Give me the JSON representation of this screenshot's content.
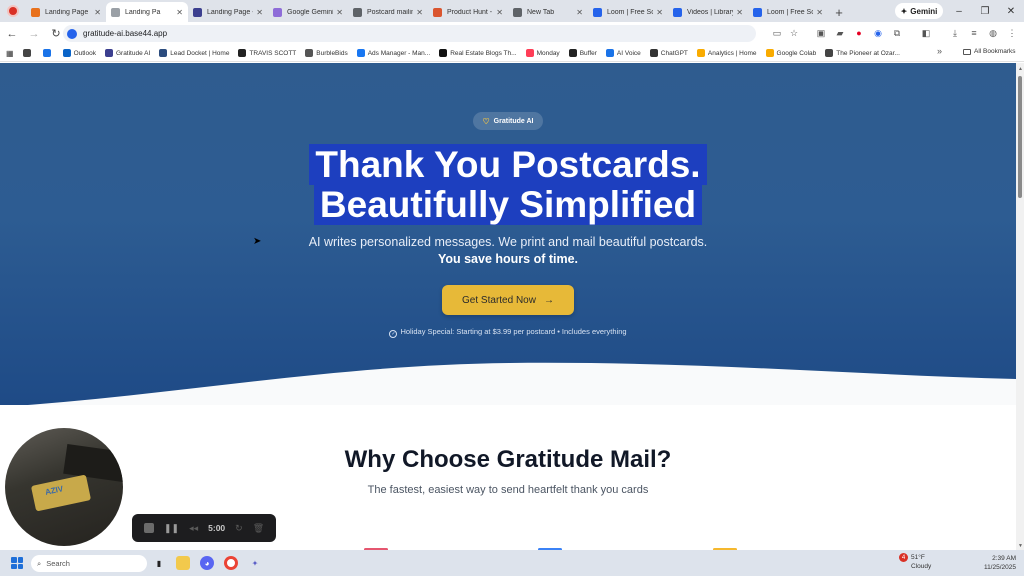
{
  "tabs": [
    {
      "label": "Landing Page",
      "color": "#e8711c"
    },
    {
      "label": "Landing Pa",
      "color": "#9aa0a6",
      "active": true
    },
    {
      "label": "Landing Page -",
      "color": "#3c3f8f"
    },
    {
      "label": "Google Gemini",
      "color": "#8e6cd8"
    },
    {
      "label": "Postcard mailin",
      "color": "#5f6368"
    },
    {
      "label": "Product Hunt -",
      "color": "#da552f"
    },
    {
      "label": "New Tab",
      "color": "#5f6368"
    },
    {
      "label": "Loom | Free Sc",
      "color": "#2563eb"
    },
    {
      "label": "Videos | Library",
      "color": "#2563eb"
    },
    {
      "label": "Loom | Free Sc",
      "color": "#2563eb"
    }
  ],
  "gemini_label": "Gemini",
  "address": "gratitude-ai.base44.app",
  "bookmarks": [
    {
      "label": "",
      "color": "#444"
    },
    {
      "label": "",
      "color": "#1a73e8"
    },
    {
      "label": "Outlook",
      "color": "#0a64c8"
    },
    {
      "label": "Gratitude AI",
      "color": "#3c3f8f"
    },
    {
      "label": "Lead Docket | Home",
      "color": "#2b4c7e"
    },
    {
      "label": "TRAVIS SCOTT",
      "color": "#222"
    },
    {
      "label": "BurbleBids",
      "color": "#555"
    },
    {
      "label": "Ads Manager - Man...",
      "color": "#1877f2"
    },
    {
      "label": "Real Estate Blogs Th...",
      "color": "#111"
    },
    {
      "label": "Monday",
      "color": "#ff3d57"
    },
    {
      "label": "Buffer",
      "color": "#222"
    },
    {
      "label": "AI Voice",
      "color": "#1a73e8"
    },
    {
      "label": "ChatGPT",
      "color": "#333"
    },
    {
      "label": "Analytics | Home",
      "color": "#f9ab00"
    },
    {
      "label": "Google Colab",
      "color": "#f9ab00"
    },
    {
      "label": "The Pioneer at Ozar...",
      "color": "#444"
    }
  ],
  "all_bookmarks": "All Bookmarks",
  "hero": {
    "badge": "Gratitude AI",
    "headline_line1": "Thank You Postcards.",
    "headline_line2": "Beautifully Simplified",
    "subtitle": "AI writes personalized messages. We print and mail beautiful postcards.",
    "subtitle_bold": "You save hours of time.",
    "cta": "Get Started Now",
    "offer": "Holiday Special: Starting at $3.99 per postcard • Includes everything"
  },
  "features": {
    "title": "Why Choose Gratitude Mail?",
    "subtitle": "The fastest, easiest way to send heartfelt thank you cards"
  },
  "webcam_card_text": "AZIV",
  "recorder": {
    "time": "5:00"
  },
  "taskbar": {
    "search_placeholder": "Search",
    "weather_temp": "51°F",
    "weather_desc": "Cloudy",
    "notification_count": "4",
    "time": "2:39 AM",
    "date": "11/25/2025"
  },
  "colors": {
    "hero": "#2d5c92",
    "cta": "#e7b938",
    "highlight": "#1d3fbf"
  }
}
